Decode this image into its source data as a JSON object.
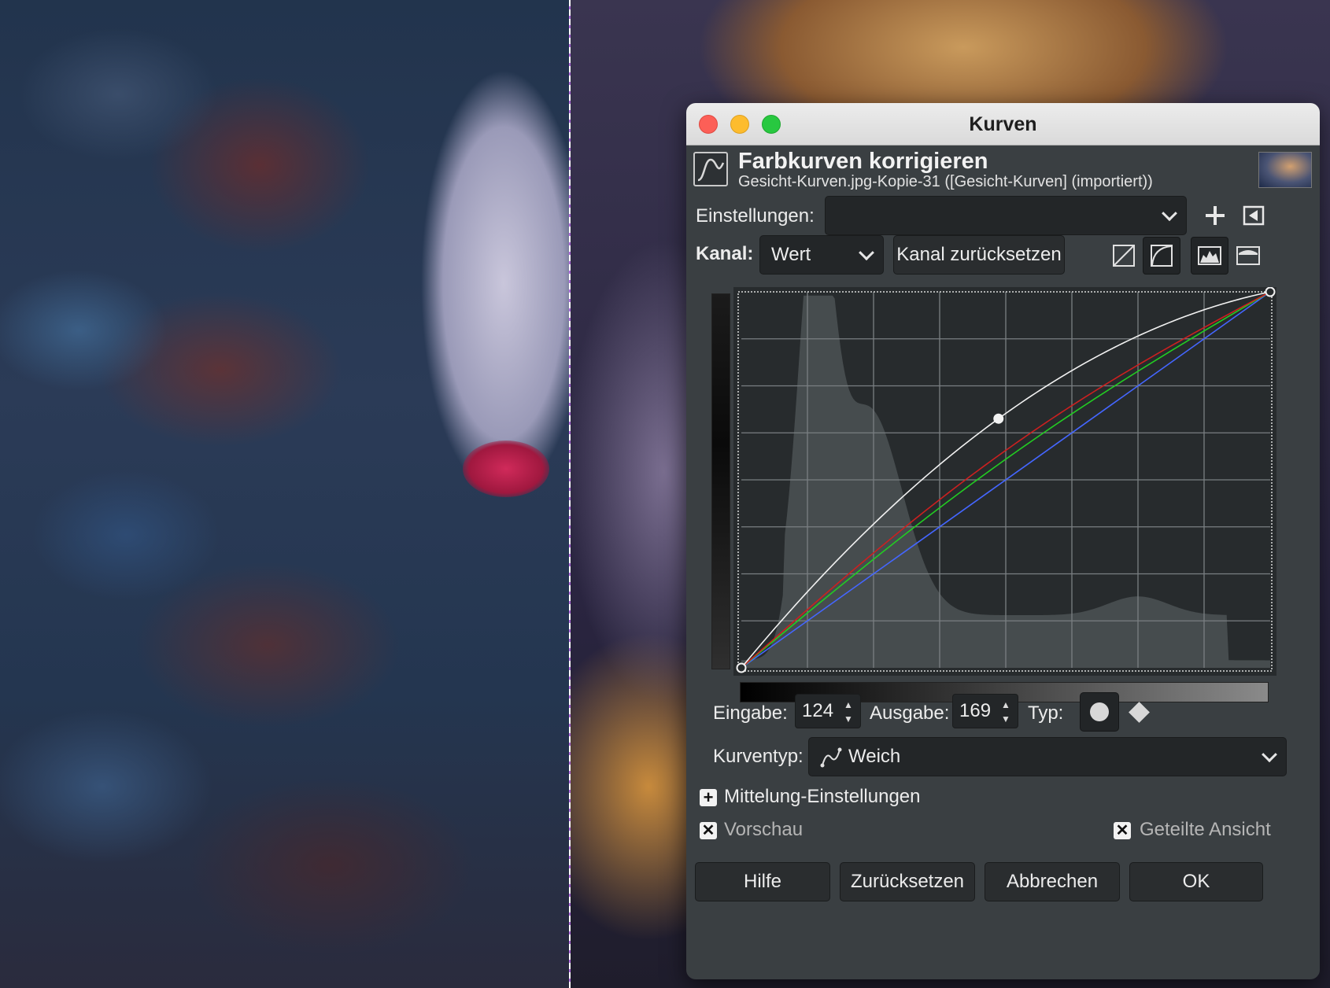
{
  "dialog": {
    "title": "Kurven",
    "header_title": "Farbkurven korrigieren",
    "header_subtitle": "Gesicht-Kurven.jpg-Kopie-31 ([Gesicht-Kurven] (importiert))",
    "header_icon": "curve-tool-icon"
  },
  "settings": {
    "label": "Einstellungen:",
    "value": ""
  },
  "channel": {
    "label": "Kanal:",
    "value": "Wert",
    "reset_button": "Kanal zurücksetzen"
  },
  "graph": {
    "grid_divisions": 8,
    "point_input": 124,
    "point_output": 169,
    "colors": {
      "value": "#f2f2f2",
      "red": "#cc2020",
      "green": "#22cc22",
      "blue": "#4466ff",
      "grid": "#7a7f82",
      "histogram": "#4a5052"
    }
  },
  "input": {
    "label": "Eingabe:",
    "value": "124"
  },
  "output": {
    "label": "Ausgabe:",
    "value": "169"
  },
  "type": {
    "label": "Typ:"
  },
  "curve_type": {
    "label": "Kurventyp:",
    "value": "Weich"
  },
  "averaging": {
    "label": "Mittelung-Einstellungen"
  },
  "preview": {
    "label": "Vorschau",
    "checked": true
  },
  "split_view": {
    "label": "Geteilte Ansicht",
    "checked": true
  },
  "buttons": {
    "help": "Hilfe",
    "reset": "Zurücksetzen",
    "cancel": "Abbrechen",
    "ok": "OK"
  }
}
